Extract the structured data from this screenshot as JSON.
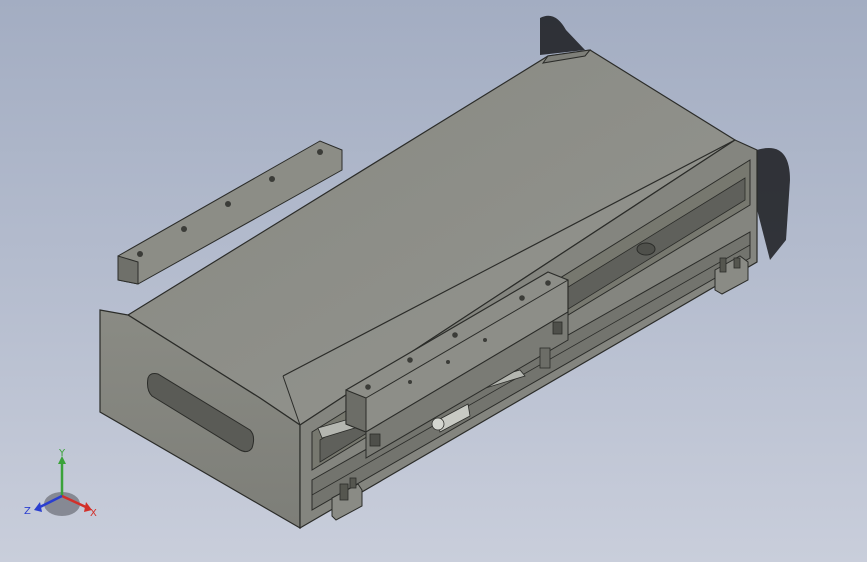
{
  "viewport": {
    "background_top": "#a3adc2",
    "background_bottom": "#c9cedb"
  },
  "model": {
    "part_type": "linear-module",
    "body_color": "#8a8b84",
    "top_color": "#8f908a",
    "side_dark_color": "#6e6f69",
    "edge_color": "#2b2c29"
  },
  "triad": {
    "x_label": "X",
    "y_label": "Y",
    "z_label": "Z",
    "x_color": "#d2302a",
    "y_color": "#3aa23a",
    "z_color": "#2a3ed0"
  }
}
